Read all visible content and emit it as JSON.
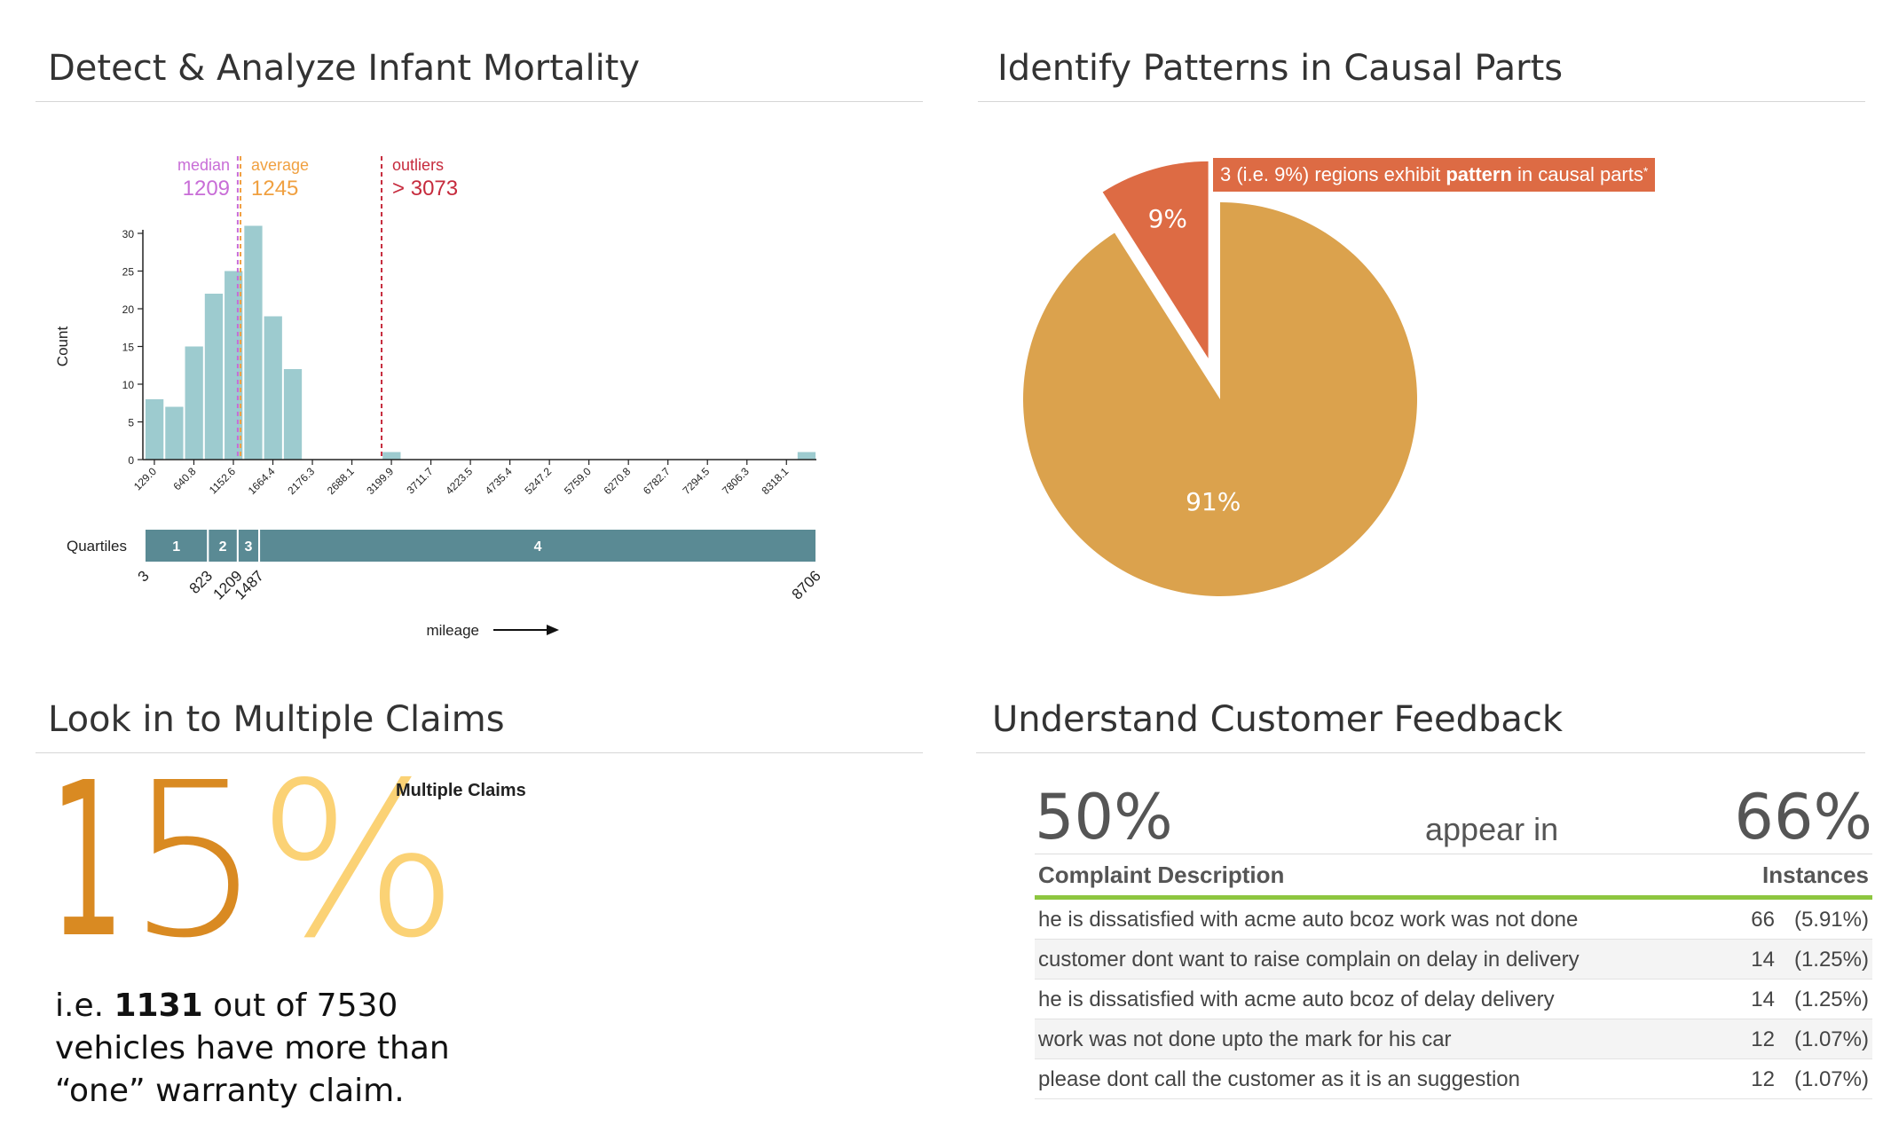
{
  "panels": {
    "infant_mortality": {
      "title": "Detect & Analyze Infant Mortality"
    },
    "causal_parts": {
      "title": "Identify Patterns in Causal Parts"
    },
    "multiple_claims": {
      "title": "Look in to Multiple Claims"
    },
    "customer_feedback": {
      "title": "Understand Customer Feedback"
    }
  },
  "chart_data": [
    {
      "type": "bar",
      "ylabel": "Count",
      "xlabel": "mileage",
      "ylim": [
        0,
        30
      ],
      "yticks": [
        0,
        5,
        10,
        15,
        20,
        25,
        30
      ],
      "bar_color": "#9dcbcf",
      "bin_start": 3,
      "bin_width": 256,
      "values": [
        8,
        7,
        15,
        22,
        25,
        31,
        19,
        12,
        0,
        0,
        0,
        0,
        1,
        0,
        0,
        0,
        0,
        0,
        0,
        0,
        0,
        0,
        0,
        0,
        0,
        0,
        0,
        0,
        0,
        0,
        0,
        0,
        0,
        1
      ],
      "tick_labels": [
        "129.0",
        "640.8",
        "1152.6",
        "1664.4",
        "2176.3",
        "2688.1",
        "3199.9",
        "3711.7",
        "4223.5",
        "4735.4",
        "5247.2",
        "5759.0",
        "6270.8",
        "6782.7",
        "7294.5",
        "7806.3",
        "8318.1"
      ],
      "tick_values": [
        129.0,
        640.8,
        1152.6,
        1664.4,
        2176.3,
        2688.1,
        3199.9,
        3711.7,
        4223.5,
        4735.4,
        5247.2,
        5759.0,
        6270.8,
        6782.7,
        7294.5,
        7806.3,
        8318.1
      ],
      "x_domain": [
        3,
        8706
      ],
      "markers": [
        {
          "label": "median",
          "value_text": "1209",
          "value": 1209,
          "color": "#c86dd7"
        },
        {
          "label": "average",
          "value_text": "1245",
          "value": 1245,
          "color": "#f0a040"
        },
        {
          "label": "outliers",
          "value_text": "> 3073",
          "value": 3073,
          "color": "#c62b3d"
        }
      ],
      "quartiles": {
        "label": "Quartiles",
        "color": "#5a8a94",
        "boundaries": [
          3,
          823,
          1209,
          1487,
          8706
        ],
        "boundary_labels": [
          "3",
          "823",
          "1209",
          "1487",
          "8706"
        ],
        "segment_labels": [
          "1",
          "2",
          "3",
          "4"
        ]
      }
    },
    {
      "type": "pie",
      "slices": [
        {
          "label": "9%",
          "value": 9,
          "color": "#dd6b44",
          "exploded": true
        },
        {
          "label": "91%",
          "value": 91,
          "color": "#dba24d",
          "exploded": false
        }
      ],
      "callout": {
        "prefix": "3 (i.e. 9%) regions exhibit ",
        "bold": "pattern",
        "suffix": " in causal parts",
        "sup": "*"
      }
    }
  ],
  "multiple_claims": {
    "big_digit_1": "1",
    "big_digit_5": "5",
    "big_percent": "%",
    "label": "Multiple Claims",
    "line1_prefix": "i.e. ",
    "line1_bold": "1131",
    "line1_suffix": " out of  7530",
    "line2": "vehicles have more than",
    "line3": "“one” warranty claim."
  },
  "customer_feedback": {
    "left_pct": "50%",
    "middle": "appear in",
    "right_pct": "66%",
    "col_description": "Complaint Description",
    "col_instances": "Instances",
    "accent_color": "#8dc63f",
    "rows": [
      {
        "description": "he is dissatisfied with acme auto bcoz work was not done",
        "count": "66",
        "percent": "(5.91%)"
      },
      {
        "description": "customer dont want to raise complain on delay in delivery",
        "count": "14",
        "percent": "(1.25%)"
      },
      {
        "description": "he is dissatisfied with acme auto bcoz of delay delivery",
        "count": "14",
        "percent": "(1.25%)"
      },
      {
        "description": "work was not done upto the mark for his car",
        "count": "12",
        "percent": "(1.07%)"
      },
      {
        "description": "please dont call the customer as it is an suggestion",
        "count": "12",
        "percent": "(1.07%)"
      }
    ]
  }
}
